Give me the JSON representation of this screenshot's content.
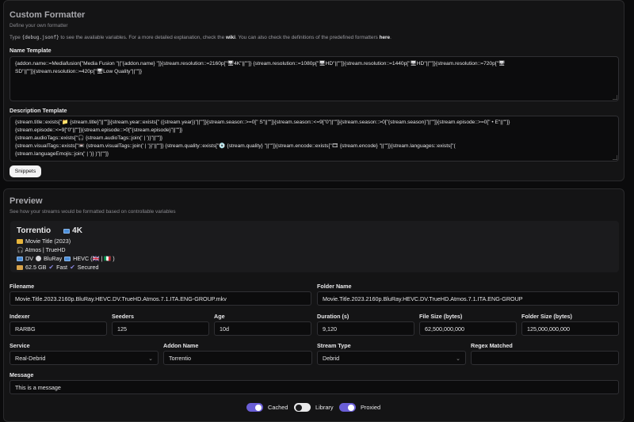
{
  "formatter": {
    "title": "Custom Formatter",
    "subtitle": "Define your own formatter",
    "description": {
      "type_text": "Type",
      "code": "{debug.jsonf}",
      "mid_text": "to see the available variables. For a more detailed explanation, check the",
      "wiki_link": "wiki",
      "end_text": ". You can also check the definitions of the predefined formatters",
      "here_link": "here",
      "period": "."
    },
    "name_template_label": "Name Template",
    "name_template_lines": [
      "{addon.name::=Mediafusion[\"Media Fusion       \"||\"{addon.name}     \"]}{stream.resolution::=2160p[\"🖥4K\"||\"\"]} {stream.resolution::=1080p[\"🖥HD\"||\"\"]}{stream.resolution::=1440p[\"🖥HD\"||\"\"]}{stream.resolution::=720p[\"🖥",
      "SD\"||\"\"]}{stream.resolution::=420p[\"🖥Low Quality\"||\"\"]}"
    ],
    "description_template_label": "Description Template",
    "description_template_lines": [
      "{stream.title::exists[\"📁 {stream.title}\"||\"\"]}{stream.year::exists[\" ({stream.year})\"||\"\"]}{stream.season::>=0[\" S\"||\"\"]}{stream.season::<=9[\"0\"||\"\"]}{stream.season::>0[\"{stream.season}\"||\"\"]}{stream.episode::>=0[\" • E\"||\"\"]}",
      "{stream.episode::<=9[\"0\"||\"\"]}{stream.episode::>0[\"{stream.episode}\"||\"\"]}",
      "{stream.audioTags::exists[\"🎧 {stream.audioTags::join(' | ')}\"||\"\"]}",
      "{stream.visualTags::exists[\"📼 {stream.visualTags::join(' | ')}\"||\"\"]} {stream.quality::exists[\"💿 {stream.quality} \"||\"\"]}{stream.encode::exists[\"🎞 {stream.encode} \"||\"\"]}{stream.languages::exists[\"(",
      "{stream.languageEmojis::join(' | ')} )\"||\"\"]}"
    ],
    "snippets_button": "Snippets"
  },
  "preview": {
    "title": "Preview",
    "subtitle": "See how your streams would be formatted based on controllable variables",
    "output": {
      "name": "Torrentio",
      "resolution": "4K",
      "title_line": "Movie Title (2023)",
      "audio_line": "🎧 Atmos | TrueHD",
      "visual_dv": "DV",
      "visual_quality": "BluRay",
      "visual_encode": "HEVC (🇬🇧 | 🇮🇹 )",
      "size": "62.5 GB",
      "fast": "Fast",
      "secured": "Secured"
    },
    "fields": {
      "filename_label": "Filename",
      "filename": "Movie.Title.2023.2160p.BluRay.HEVC.DV.TrueHD.Atmos.7.1.ITA.ENG-GROUP.mkv",
      "folder_label": "Folder Name",
      "folder": "Movie.Title.2023.2160p.BluRay.HEVC.DV.TrueHD.Atmos.7.1.ITA.ENG-GROUP",
      "indexer_label": "Indexer",
      "indexer": "RARBG",
      "seeders_label": "Seeders",
      "seeders": "125",
      "age_label": "Age",
      "age": "10d",
      "duration_label": "Duration (s)",
      "duration": "9,120",
      "file_size_label": "File Size (bytes)",
      "file_size": "62,500,000,000",
      "folder_size_label": "Folder Size (bytes)",
      "folder_size": "125,000,000,000",
      "service_label": "Service",
      "service": "Real-Debrid",
      "addon_name_label": "Addon Name",
      "addon_name": "Torrentio",
      "stream_type_label": "Stream Type",
      "stream_type": "Debrid",
      "regex_label": "Regex Matched",
      "regex": "",
      "message_label": "Message",
      "message": "This is a message"
    },
    "toggles": [
      {
        "label": "Cached",
        "on": true
      },
      {
        "label": "Library",
        "on": false
      },
      {
        "label": "Proxied",
        "on": true
      }
    ]
  },
  "colors": {
    "accent": "#6a5ed6",
    "background": "#0b0b0c",
    "card": "#141415"
  }
}
